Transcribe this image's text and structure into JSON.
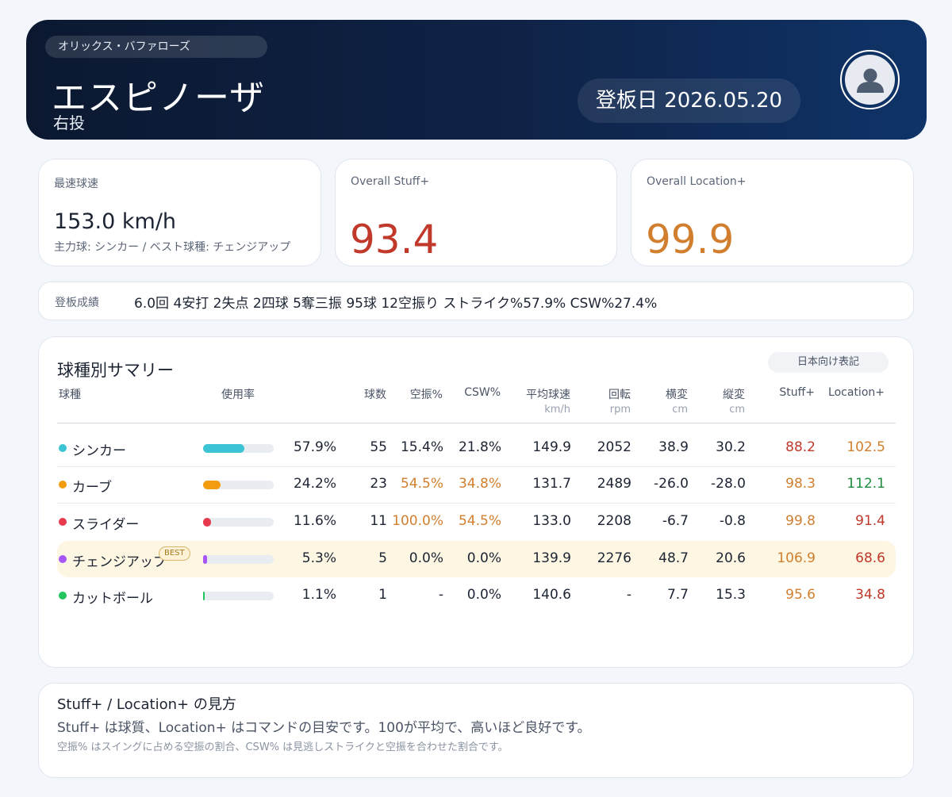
{
  "header": {
    "team": "オリックス・バファローズ",
    "player_name": "エスピノーザ",
    "throws": "右投",
    "date_text": "登板日 2026.05.20"
  },
  "kpis": {
    "velocity": {
      "label": "最速球速",
      "value": "153.0 km/h",
      "sub": "主力球: シンカー / ベスト球種: チェンジアップ"
    },
    "stuff": {
      "label": "Overall Stuff+",
      "value": "93.4",
      "color": "#c0392b"
    },
    "location": {
      "label": "Overall Location+",
      "value": "99.9",
      "color": "#d17f2e"
    }
  },
  "results": {
    "label": "登板成績",
    "text": "6.0回 4安打 2失点 2四球 5奪三振 95球 12空振り ストライク%57.9% CSW%27.4%"
  },
  "summary": {
    "title": "球種別サマリー",
    "toggle_label": "日本向け表記",
    "columns": {
      "pitch": "球種",
      "usage": "使用率",
      "count": "球数",
      "whiff": "空振%",
      "csw": "CSW%",
      "velo": "平均球速",
      "velo_unit": "km/h",
      "spin": "回転",
      "spin_unit": "rpm",
      "hbreak": "横変",
      "hbreak_unit": "cm",
      "vbreak": "縦変",
      "vbreak_unit": "cm",
      "stuff": "Stuff+",
      "location": "Location+"
    },
    "best_badge": "BEST",
    "rows": [
      {
        "pitch": "シンカー",
        "dot": "#3cc4d4",
        "usage": "57.9%",
        "usage_frac": 0.579,
        "count": "55",
        "whiff": "15.4%",
        "whiff_color": "#1c2433",
        "csw": "21.8%",
        "csw_color": "#1c2433",
        "velo": "149.9",
        "spin": "2052",
        "hbreak": "38.9",
        "vbreak": "30.2",
        "stuff": "88.2",
        "stuff_color": "#c0392b",
        "location": "102.5",
        "location_color": "#d17f2e",
        "best": false
      },
      {
        "pitch": "カーブ",
        "dot": "#f39c12",
        "usage": "24.2%",
        "usage_frac": 0.242,
        "count": "23",
        "whiff": "54.5%",
        "whiff_color": "#d17f2e",
        "csw": "34.8%",
        "csw_color": "#d17f2e",
        "velo": "131.7",
        "spin": "2489",
        "hbreak": "-26.0",
        "vbreak": "-28.0",
        "stuff": "98.3",
        "stuff_color": "#d17f2e",
        "location": "112.1",
        "location_color": "#1e8e3e",
        "best": false
      },
      {
        "pitch": "スライダー",
        "dot": "#e8394f",
        "usage": "11.6%",
        "usage_frac": 0.116,
        "count": "11",
        "whiff": "100.0%",
        "whiff_color": "#d17f2e",
        "csw": "54.5%",
        "csw_color": "#d17f2e",
        "velo": "133.0",
        "spin": "2208",
        "hbreak": "-6.7",
        "vbreak": "-0.8",
        "stuff": "99.8",
        "stuff_color": "#d17f2e",
        "location": "91.4",
        "location_color": "#c0392b",
        "best": false
      },
      {
        "pitch": "チェンジアップ",
        "dot": "#a855f7",
        "usage": "5.3%",
        "usage_frac": 0.053,
        "count": "5",
        "whiff": "0.0%",
        "whiff_color": "#1c2433",
        "csw": "0.0%",
        "csw_color": "#1c2433",
        "velo": "139.9",
        "spin": "2276",
        "hbreak": "48.7",
        "vbreak": "20.6",
        "stuff": "106.9",
        "stuff_color": "#d17f2e",
        "location": "68.6",
        "location_color": "#c0392b",
        "best": true
      },
      {
        "pitch": "カットボール",
        "dot": "#22c55e",
        "usage": "1.1%",
        "usage_frac": 0.011,
        "count": "1",
        "whiff": "-",
        "whiff_color": "#1c2433",
        "csw": "0.0%",
        "csw_color": "#1c2433",
        "velo": "140.6",
        "spin": "-",
        "hbreak": "7.7",
        "vbreak": "15.3",
        "stuff": "95.6",
        "stuff_color": "#d17f2e",
        "location": "34.8",
        "location_color": "#c0392b",
        "best": false
      }
    ]
  },
  "explain": {
    "title": "Stuff+ / Location+ の見方",
    "line": "Stuff+ は球質、Location+ はコマンドの目安です。100が平均で、高いほど良好です。",
    "note": "空振% はスイングに占める空振の割合、CSW% は見逃しストライクと空振を合わせた割合です。"
  }
}
